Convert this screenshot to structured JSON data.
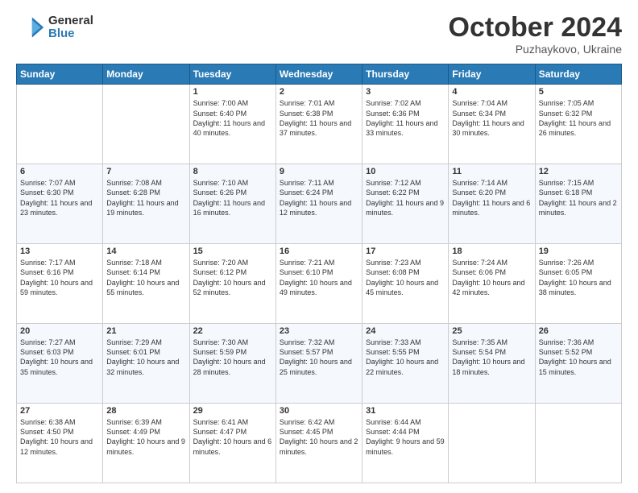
{
  "header": {
    "logo_general": "General",
    "logo_blue": "Blue",
    "month": "October 2024",
    "location": "Puzhaykovo, Ukraine"
  },
  "days_of_week": [
    "Sunday",
    "Monday",
    "Tuesday",
    "Wednesday",
    "Thursday",
    "Friday",
    "Saturday"
  ],
  "weeks": [
    [
      {
        "day": "",
        "sunrise": "",
        "sunset": "",
        "daylight": ""
      },
      {
        "day": "",
        "sunrise": "",
        "sunset": "",
        "daylight": ""
      },
      {
        "day": "1",
        "sunrise": "Sunrise: 7:00 AM",
        "sunset": "Sunset: 6:40 PM",
        "daylight": "Daylight: 11 hours and 40 minutes."
      },
      {
        "day": "2",
        "sunrise": "Sunrise: 7:01 AM",
        "sunset": "Sunset: 6:38 PM",
        "daylight": "Daylight: 11 hours and 37 minutes."
      },
      {
        "day": "3",
        "sunrise": "Sunrise: 7:02 AM",
        "sunset": "Sunset: 6:36 PM",
        "daylight": "Daylight: 11 hours and 33 minutes."
      },
      {
        "day": "4",
        "sunrise": "Sunrise: 7:04 AM",
        "sunset": "Sunset: 6:34 PM",
        "daylight": "Daylight: 11 hours and 30 minutes."
      },
      {
        "day": "5",
        "sunrise": "Sunrise: 7:05 AM",
        "sunset": "Sunset: 6:32 PM",
        "daylight": "Daylight: 11 hours and 26 minutes."
      }
    ],
    [
      {
        "day": "6",
        "sunrise": "Sunrise: 7:07 AM",
        "sunset": "Sunset: 6:30 PM",
        "daylight": "Daylight: 11 hours and 23 minutes."
      },
      {
        "day": "7",
        "sunrise": "Sunrise: 7:08 AM",
        "sunset": "Sunset: 6:28 PM",
        "daylight": "Daylight: 11 hours and 19 minutes."
      },
      {
        "day": "8",
        "sunrise": "Sunrise: 7:10 AM",
        "sunset": "Sunset: 6:26 PM",
        "daylight": "Daylight: 11 hours and 16 minutes."
      },
      {
        "day": "9",
        "sunrise": "Sunrise: 7:11 AM",
        "sunset": "Sunset: 6:24 PM",
        "daylight": "Daylight: 11 hours and 12 minutes."
      },
      {
        "day": "10",
        "sunrise": "Sunrise: 7:12 AM",
        "sunset": "Sunset: 6:22 PM",
        "daylight": "Daylight: 11 hours and 9 minutes."
      },
      {
        "day": "11",
        "sunrise": "Sunrise: 7:14 AM",
        "sunset": "Sunset: 6:20 PM",
        "daylight": "Daylight: 11 hours and 6 minutes."
      },
      {
        "day": "12",
        "sunrise": "Sunrise: 7:15 AM",
        "sunset": "Sunset: 6:18 PM",
        "daylight": "Daylight: 11 hours and 2 minutes."
      }
    ],
    [
      {
        "day": "13",
        "sunrise": "Sunrise: 7:17 AM",
        "sunset": "Sunset: 6:16 PM",
        "daylight": "Daylight: 10 hours and 59 minutes."
      },
      {
        "day": "14",
        "sunrise": "Sunrise: 7:18 AM",
        "sunset": "Sunset: 6:14 PM",
        "daylight": "Daylight: 10 hours and 55 minutes."
      },
      {
        "day": "15",
        "sunrise": "Sunrise: 7:20 AM",
        "sunset": "Sunset: 6:12 PM",
        "daylight": "Daylight: 10 hours and 52 minutes."
      },
      {
        "day": "16",
        "sunrise": "Sunrise: 7:21 AM",
        "sunset": "Sunset: 6:10 PM",
        "daylight": "Daylight: 10 hours and 49 minutes."
      },
      {
        "day": "17",
        "sunrise": "Sunrise: 7:23 AM",
        "sunset": "Sunset: 6:08 PM",
        "daylight": "Daylight: 10 hours and 45 minutes."
      },
      {
        "day": "18",
        "sunrise": "Sunrise: 7:24 AM",
        "sunset": "Sunset: 6:06 PM",
        "daylight": "Daylight: 10 hours and 42 minutes."
      },
      {
        "day": "19",
        "sunrise": "Sunrise: 7:26 AM",
        "sunset": "Sunset: 6:05 PM",
        "daylight": "Daylight: 10 hours and 38 minutes."
      }
    ],
    [
      {
        "day": "20",
        "sunrise": "Sunrise: 7:27 AM",
        "sunset": "Sunset: 6:03 PM",
        "daylight": "Daylight: 10 hours and 35 minutes."
      },
      {
        "day": "21",
        "sunrise": "Sunrise: 7:29 AM",
        "sunset": "Sunset: 6:01 PM",
        "daylight": "Daylight: 10 hours and 32 minutes."
      },
      {
        "day": "22",
        "sunrise": "Sunrise: 7:30 AM",
        "sunset": "Sunset: 5:59 PM",
        "daylight": "Daylight: 10 hours and 28 minutes."
      },
      {
        "day": "23",
        "sunrise": "Sunrise: 7:32 AM",
        "sunset": "Sunset: 5:57 PM",
        "daylight": "Daylight: 10 hours and 25 minutes."
      },
      {
        "day": "24",
        "sunrise": "Sunrise: 7:33 AM",
        "sunset": "Sunset: 5:55 PM",
        "daylight": "Daylight: 10 hours and 22 minutes."
      },
      {
        "day": "25",
        "sunrise": "Sunrise: 7:35 AM",
        "sunset": "Sunset: 5:54 PM",
        "daylight": "Daylight: 10 hours and 18 minutes."
      },
      {
        "day": "26",
        "sunrise": "Sunrise: 7:36 AM",
        "sunset": "Sunset: 5:52 PM",
        "daylight": "Daylight: 10 hours and 15 minutes."
      }
    ],
    [
      {
        "day": "27",
        "sunrise": "Sunrise: 6:38 AM",
        "sunset": "Sunset: 4:50 PM",
        "daylight": "Daylight: 10 hours and 12 minutes."
      },
      {
        "day": "28",
        "sunrise": "Sunrise: 6:39 AM",
        "sunset": "Sunset: 4:49 PM",
        "daylight": "Daylight: 10 hours and 9 minutes."
      },
      {
        "day": "29",
        "sunrise": "Sunrise: 6:41 AM",
        "sunset": "Sunset: 4:47 PM",
        "daylight": "Daylight: 10 hours and 6 minutes."
      },
      {
        "day": "30",
        "sunrise": "Sunrise: 6:42 AM",
        "sunset": "Sunset: 4:45 PM",
        "daylight": "Daylight: 10 hours and 2 minutes."
      },
      {
        "day": "31",
        "sunrise": "Sunrise: 6:44 AM",
        "sunset": "Sunset: 4:44 PM",
        "daylight": "Daylight: 9 hours and 59 minutes."
      },
      {
        "day": "",
        "sunrise": "",
        "sunset": "",
        "daylight": ""
      },
      {
        "day": "",
        "sunrise": "",
        "sunset": "",
        "daylight": ""
      }
    ]
  ]
}
